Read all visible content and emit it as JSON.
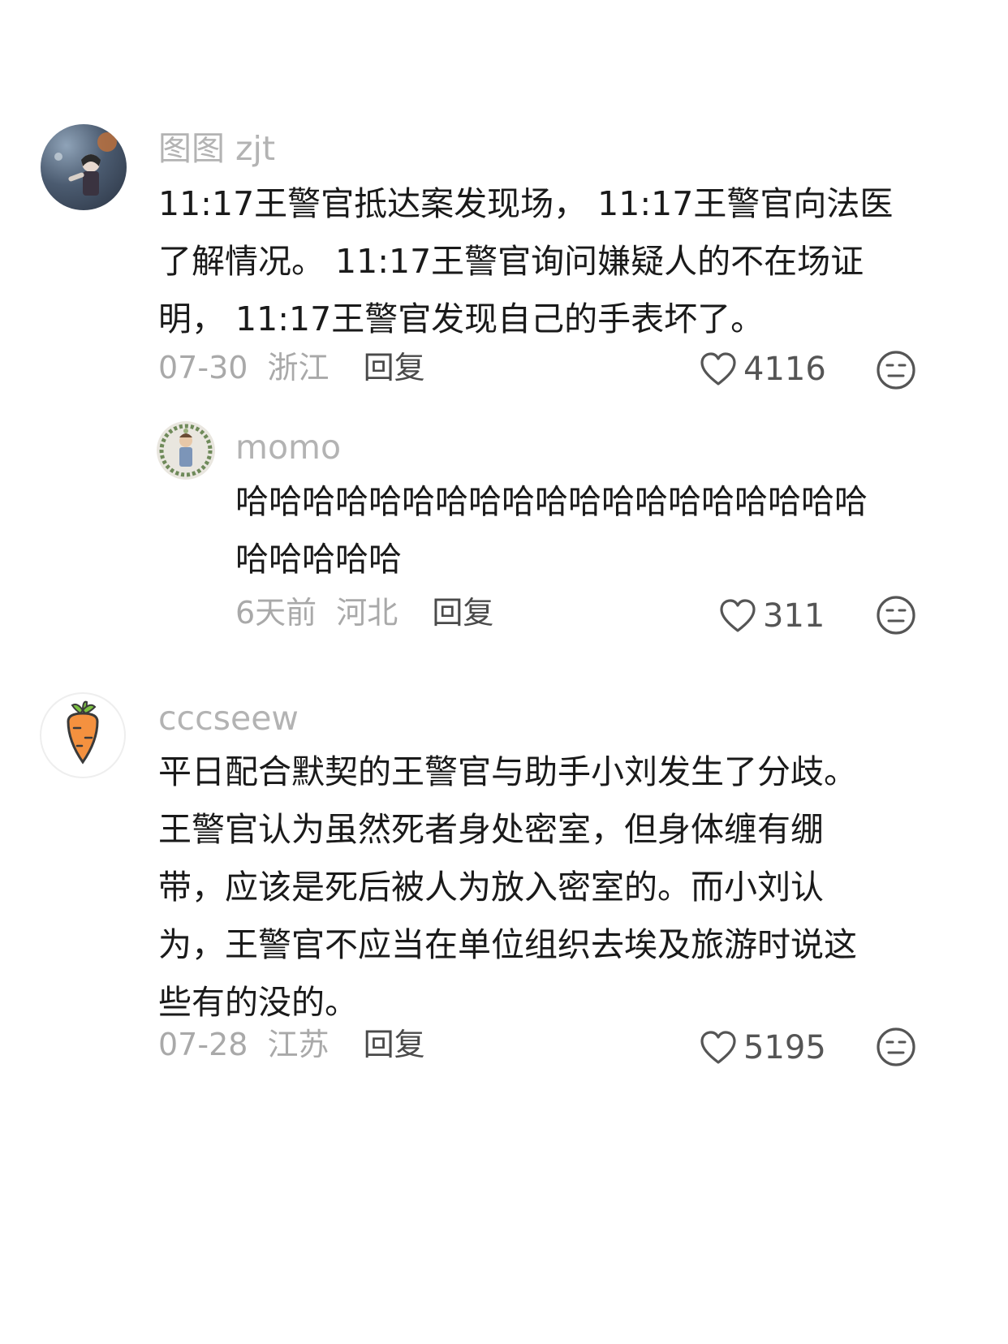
{
  "comments": [
    {
      "username": "图图 zjt",
      "lines": [
        "11:17王警官抵达案发现场， 11:17王警官向法医",
        "了解情况。 11:17王警官询问嫌疑人的不在场证",
        "明， 11:17王警官发现自己的手表坏了。"
      ],
      "date": "07-30",
      "region": "浙江",
      "reply_label": "回复",
      "likes": "4116",
      "reply": {
        "username": "momo",
        "lines": [
          "哈哈哈哈哈哈哈哈哈哈哈哈哈哈哈哈哈哈哈",
          "哈哈哈哈哈"
        ],
        "date": "6天前",
        "region": "河北",
        "reply_label": "回复",
        "likes": "311"
      }
    },
    {
      "username": "cccseew",
      "lines": [
        "平日配合默契的王警官与助手小刘发生了分歧。",
        "王警官认为虽然死者身处密室，但身体缠有绷",
        "带，应该是死后被人为放入密室的。而小刘认",
        "为，王警官不应当在单位组织去埃及旅游时说这",
        "些有的没的。"
      ],
      "date": "07-28",
      "region": "江苏",
      "reply_label": "回复",
      "likes": "5195"
    }
  ],
  "icons": {
    "like": "heart-outline-icon",
    "reaction": "meh-face-icon",
    "avatar_2": "carrot-icon"
  },
  "colors": {
    "text": "#1a1a1a",
    "username": "#b3b3b3",
    "meta": "#a9a9a9",
    "reply": "#4a4a4a",
    "icon": "#555555"
  }
}
